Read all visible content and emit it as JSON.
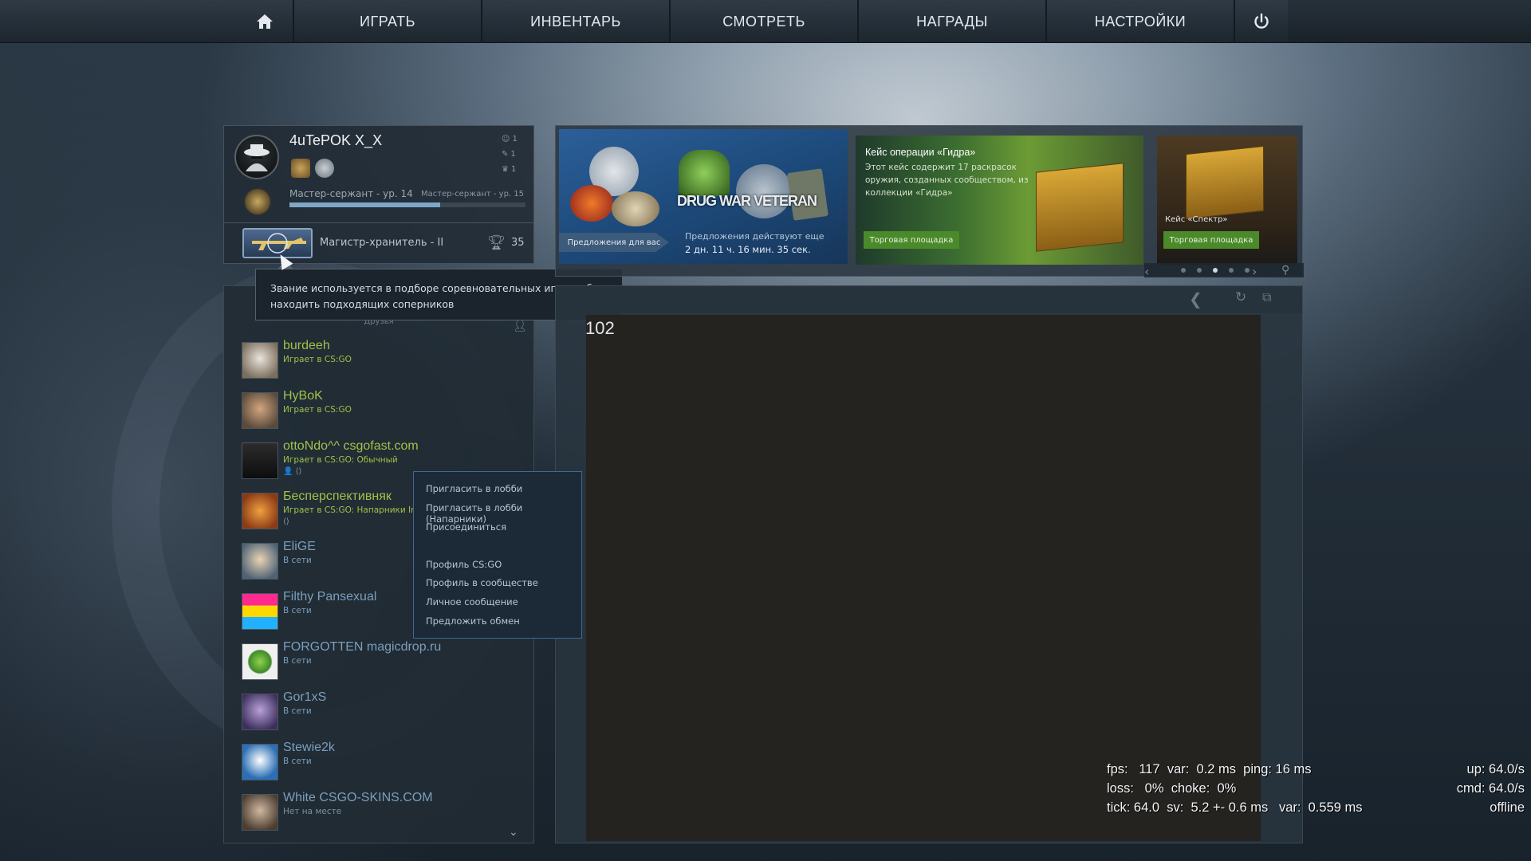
{
  "nav": {
    "home_icon": "home-icon",
    "items": [
      "ИГРАТЬ",
      "ИНВЕНТАРЬ",
      "СМОТРЕТЬ",
      "НАГРАДЫ",
      "НАСТРОЙКИ"
    ],
    "power_icon": "power-icon"
  },
  "profile": {
    "name": "4uTePOK X_X",
    "stats": [
      "1",
      "1",
      "1"
    ],
    "xp_left": "Мастер-сержант - ур. 14",
    "xp_right": "Мастер-сержант - ур. 15",
    "xp_progress": 0.64,
    "rank_name": "Магистр-хранитель - II",
    "trophies": "35"
  },
  "tooltip": {
    "text": "Звание используется в подборе соревновательных игр, чтобы находить подходящих соперников"
  },
  "friends": {
    "header": "Друзья",
    "list": [
      {
        "name": "burdeeh",
        "status": "Играет в CS:GO",
        "sub": "",
        "state": "game"
      },
      {
        "name": "HyBoK",
        "status": "Играет в CS:GO",
        "sub": "",
        "state": "game"
      },
      {
        "name": "ottoNdo^^ csgofast.com",
        "status": "Играет в CS:GO: Обычный",
        "sub": "👤 ⟨⟩",
        "state": "game"
      },
      {
        "name": "Бесперспективняк",
        "status": "Играет в CS:GO: Напарники Inf",
        "sub": "⟨⟩",
        "state": "game"
      },
      {
        "name": "EliGE",
        "status": "В сети",
        "sub": "",
        "state": "online"
      },
      {
        "name": "Filthy Pansexual",
        "status": "В сети",
        "sub": "",
        "state": "online"
      },
      {
        "name": "FORGOTTEN magicdrop.ru",
        "status": "В сети",
        "sub": "",
        "state": "online"
      },
      {
        "name": "Gor1xS",
        "status": "В сети",
        "sub": "",
        "state": "online"
      },
      {
        "name": "Stewie2k",
        "status": "В сети",
        "sub": "",
        "state": "online"
      },
      {
        "name": "White CSGO-SKINS.COM",
        "status": "Нет на месте",
        "sub": "",
        "state": "away"
      }
    ]
  },
  "context_menu": {
    "items": [
      "Пригласить в лобби",
      "Пригласить в лобби (Напарники)",
      "Присоединиться",
      "Профиль CS:GO",
      "Профиль в сообществе",
      "Личное сообщение",
      "Предложить обмен"
    ]
  },
  "banners": {
    "b1": {
      "logo": "DRUG WAR VETERAN",
      "button": "Предложения для вас",
      "line1": "Предложения действуют еще",
      "line2": "2 дн.  11 ч.  16 мин.  35 сек."
    },
    "b2": {
      "title": "Кейс операции «Гидра»",
      "desc": "Этот кейс содержит 17 раскрасок оружия, созданных сообществом, из коллекции «Гидра»",
      "button": "Торговая площадка"
    },
    "b3": {
      "title": "Кейс «Спектр»",
      "button": "Торговая площадка"
    },
    "dots": 5,
    "active_dot": 2
  },
  "main": {
    "number": "102"
  },
  "netgraph": {
    "line1": "fps:   117  var:  0.2 ms  ping: 16 ms",
    "line2": "loss:   0%  choke:  0%",
    "line3": "tick: 64.0  sv:  5.2 +- 0.6 ms   var:  0.559 ms",
    "r1": "up: 64.0/s",
    "r2": "cmd: 64.0/s",
    "r3": "offline"
  }
}
